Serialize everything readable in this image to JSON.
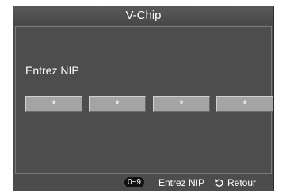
{
  "screen": {
    "title": "V-Chip"
  },
  "pin_entry": {
    "prompt": "Entrez NIP",
    "digits": [
      "*",
      "*",
      "*",
      "*"
    ]
  },
  "footer": {
    "key_range": "0~9",
    "enter_label": "Entrez NIP",
    "return_label": "Retour",
    "return_icon": "return-arrow-icon"
  }
}
